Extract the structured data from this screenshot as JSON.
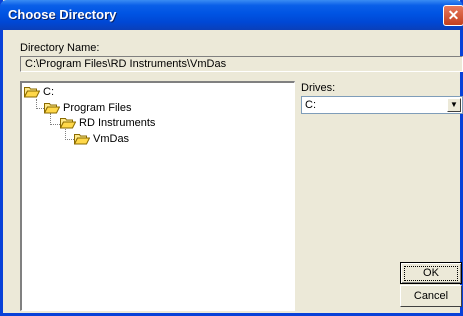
{
  "window": {
    "title": "Choose Directory",
    "close_symbol": "✕"
  },
  "directory": {
    "label": "Directory Name:",
    "value": "C:\\Program Files\\RD Instruments\\VmDas"
  },
  "tree": {
    "nodes": [
      {
        "label": "C:"
      },
      {
        "label": "Program Files"
      },
      {
        "label": "RD Instruments"
      },
      {
        "label": "VmDas"
      }
    ]
  },
  "drives": {
    "label": "Drives:",
    "selected": "C:",
    "arrow": "▼"
  },
  "buttons": {
    "ok": "OK",
    "cancel": "Cancel"
  },
  "colors": {
    "titlebar": "#0054e3",
    "dialog_bg": "#ece9d8",
    "folder": "#ffd84a"
  }
}
